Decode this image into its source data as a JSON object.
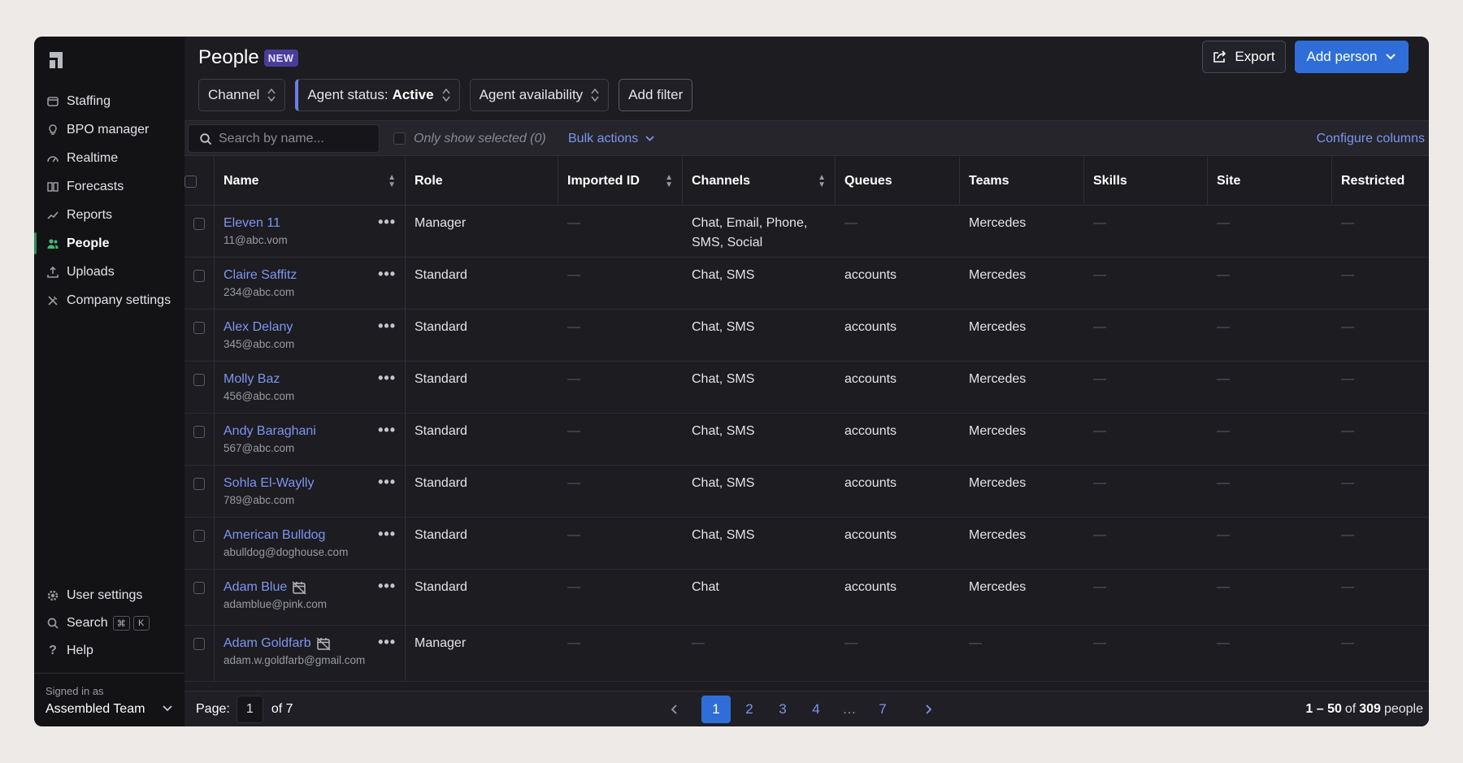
{
  "sidebar": {
    "nav": [
      {
        "label": "Staffing",
        "icon": "staffing-icon"
      },
      {
        "label": "BPO manager",
        "icon": "lightbulb-icon"
      },
      {
        "label": "Realtime",
        "icon": "gauge-icon"
      },
      {
        "label": "Forecasts",
        "icon": "book-icon"
      },
      {
        "label": "Reports",
        "icon": "chart-line-icon"
      },
      {
        "label": "People",
        "icon": "people-icon",
        "active": true
      },
      {
        "label": "Uploads",
        "icon": "upload-icon"
      },
      {
        "label": "Company settings",
        "icon": "tools-icon"
      }
    ],
    "bottom": {
      "user_settings": "User settings",
      "search": "Search",
      "search_kbd1": "⌘",
      "search_kbd2": "K",
      "help": "Help"
    },
    "signed_in_label": "Signed in as",
    "team": "Assembled Team"
  },
  "header": {
    "title": "People",
    "badge": "NEW",
    "export_label": "Export",
    "add_person_label": "Add person",
    "filters": {
      "channel": "Channel",
      "agent_status_prefix": "Agent status:",
      "agent_status_value": "Active",
      "agent_availability": "Agent availability",
      "add_filter": "Add filter"
    }
  },
  "toolbar": {
    "search_placeholder": "Search by name...",
    "only_selected": "Only show selected (0)",
    "bulk_actions": "Bulk actions",
    "configure_columns": "Configure columns"
  },
  "columns": {
    "name": "Name",
    "role": "Role",
    "imported_id": "Imported ID",
    "channels": "Channels",
    "queues": "Queues",
    "teams": "Teams",
    "skills": "Skills",
    "site": "Site",
    "restricted": "Restricted"
  },
  "dash": "—",
  "rows": [
    {
      "name": "Eleven 11",
      "email": "11@abc.vom",
      "role": "Manager",
      "imported_id": "—",
      "channels": "Chat, Email, Phone, SMS, Social",
      "queues": "—",
      "teams": "Mercedes",
      "skills": "—",
      "site": "—",
      "restricted": "—"
    },
    {
      "name": "Claire Saffitz",
      "email": "234@abc.com",
      "role": "Standard",
      "imported_id": "—",
      "channels": "Chat, SMS",
      "queues": "accounts",
      "teams": "Mercedes",
      "skills": "—",
      "site": "—",
      "restricted": "—"
    },
    {
      "name": "Alex Delany",
      "email": "345@abc.com",
      "role": "Standard",
      "imported_id": "—",
      "channels": "Chat, SMS",
      "queues": "accounts",
      "teams": "Mercedes",
      "skills": "—",
      "site": "—",
      "restricted": "—"
    },
    {
      "name": "Molly Baz",
      "email": "456@abc.com",
      "role": "Standard",
      "imported_id": "—",
      "channels": "Chat, SMS",
      "queues": "accounts",
      "teams": "Mercedes",
      "skills": "—",
      "site": "—",
      "restricted": "—"
    },
    {
      "name": "Andy Baraghani",
      "email": "567@abc.com",
      "role": "Standard",
      "imported_id": "—",
      "channels": "Chat, SMS",
      "queues": "accounts",
      "teams": "Mercedes",
      "skills": "—",
      "site": "—",
      "restricted": "—"
    },
    {
      "name": "Sohla El-Waylly",
      "email": "789@abc.com",
      "role": "Standard",
      "imported_id": "—",
      "channels": "Chat, SMS",
      "queues": "accounts",
      "teams": "Mercedes",
      "skills": "—",
      "site": "—",
      "restricted": "—"
    },
    {
      "name": "American Bulldog",
      "email": "abulldog@doghouse.com",
      "role": "Standard",
      "imported_id": "—",
      "channels": "Chat, SMS",
      "queues": "accounts",
      "teams": "Mercedes",
      "skills": "—",
      "site": "—",
      "restricted": "—"
    },
    {
      "name": "Adam Blue",
      "email": "adamblue@pink.com",
      "role": "Standard",
      "imported_id": "—",
      "channels": "Chat",
      "queues": "accounts",
      "teams": "Mercedes",
      "skills": "—",
      "site": "—",
      "restricted": "—",
      "no_schedule_icon": true
    },
    {
      "name": "Adam Goldfarb",
      "email": "adam.w.goldfarb@gmail.com",
      "role": "Manager",
      "imported_id": "—",
      "channels": "—",
      "queues": "—",
      "teams": "—",
      "skills": "—",
      "site": "—",
      "restricted": "—",
      "no_schedule_icon": true
    }
  ],
  "footer": {
    "page_label": "Page:",
    "page_value": "1",
    "of_label": "of 7",
    "pages": [
      "1",
      "2",
      "3",
      "4",
      "…",
      "7"
    ],
    "current_page": "1",
    "range": "1 – 50",
    "of_word": "of",
    "total": "309",
    "people_word": "people"
  },
  "colors": {
    "accent": "#2f6ed9",
    "link": "#7f95ef",
    "active_nav": "#43b875",
    "badge": "#4a3d9a"
  }
}
